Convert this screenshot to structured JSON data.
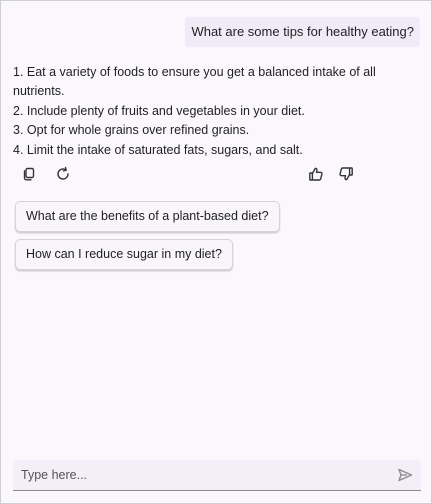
{
  "chat": {
    "user_message": "What are some tips for healthy eating?",
    "response_lines": [
      "1. Eat a variety of foods to ensure you get a balanced intake of all nutrients.",
      "2. Include plenty of fruits and vegetables in your diet.",
      "3. Opt for whole grains over refined grains.",
      "4. Limit the intake of saturated fats, sugars, and salt."
    ]
  },
  "toolbar": {
    "icons": [
      "copy-icon",
      "regenerate-icon",
      "thumbs-up-icon",
      "thumbs-down-icon"
    ]
  },
  "suggestions": [
    "What are the benefits of a plant-based diet?",
    "How can I reduce sugar in my diet?"
  ],
  "input": {
    "placeholder": "Type here...",
    "value": ""
  },
  "icons": {
    "send": "send-icon"
  }
}
